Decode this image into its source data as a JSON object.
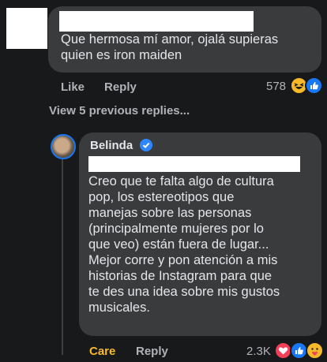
{
  "comment": {
    "text": "Que hermosa mí amor, ojalá supieras\nquien es iron maiden",
    "actions": {
      "like": "Like",
      "reply": "Reply"
    },
    "reaction_count": "578",
    "reactions": [
      "haha-icon",
      "like-icon"
    ]
  },
  "view_previous": "View 5 previous replies...",
  "reply": {
    "author": "Belinda",
    "verified": true,
    "text": "Creo que te falta algo de cultura\npop, los estereotipos que\nmanejas sobre las personas\n(principalmente mujeres por lo\nque veo) están fuera de lugar...\nMejor corre y pon atención a mis\nhistorias de Instagram para que\nte des una idea sobre mis gustos\nmusicales.",
    "actions": {
      "care": "Care",
      "reply": "Reply"
    },
    "reaction_count": "2.3K",
    "reactions": [
      "love-icon",
      "like-icon",
      "care-icon"
    ]
  },
  "colors": {
    "background": "#18191a",
    "bubble": "#3a3b3c",
    "care_accent": "#f7b928",
    "like_blue": "#1877f2",
    "love_red": "#f33e58"
  }
}
